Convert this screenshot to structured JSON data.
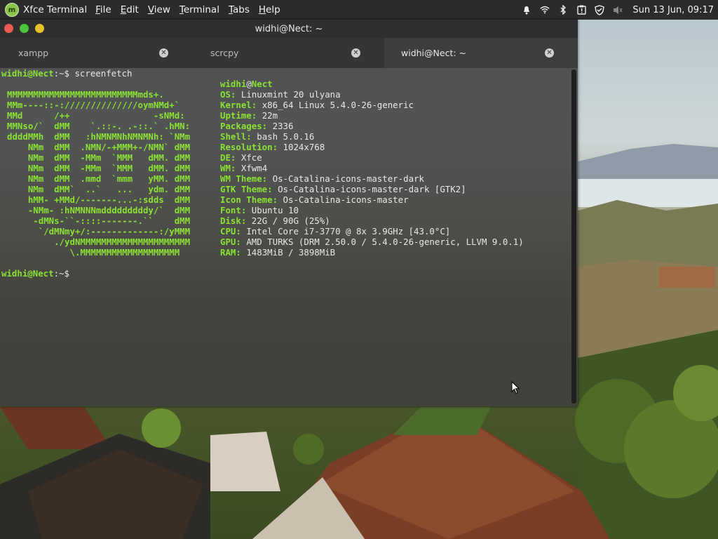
{
  "panel": {
    "app_name": "Xfce Terminal",
    "menus": [
      {
        "first": "F",
        "rest": "ile"
      },
      {
        "first": "E",
        "rest": "dit"
      },
      {
        "first": "V",
        "rest": "iew"
      },
      {
        "first": "T",
        "rest": "erminal"
      },
      {
        "first": "T",
        "rest": "abs"
      },
      {
        "first": "H",
        "rest": "elp"
      }
    ],
    "clock": "Sun 13 Jun, 09:17",
    "tray_icons": [
      "bell-icon",
      "wifi-icon",
      "bluetooth-icon",
      "clipboard-icon",
      "shield-icon",
      "volume-muted-icon"
    ]
  },
  "window": {
    "title": "widhi@Nect: ~",
    "tabs": [
      {
        "label": "xampp",
        "active": false
      },
      {
        "label": "scrcpy",
        "active": false
      },
      {
        "label": "widhi@Nect: ~",
        "active": true
      }
    ]
  },
  "terminal": {
    "prompt_user": "widhi@Nect",
    "prompt_path": ":~$ ",
    "command": "screenfetch",
    "logo_lines": [
      "MMMMMMMMMMMMMMMMMMMMMMMMMmds+.",
      "MMm----::-://////////////oymNMd+`",
      "MMd      /++                -sNMd:",
      "MMNso/`  dMM    `.::-. .-::.` .hMN:",
      "ddddMMh  dMM   :hNMNMNhNMNMNh: `NMm",
      "    NMm  dMM  .NMN/-+MMM+-/NMN` dMM",
      "    NMm  dMM  -MMm  `MMM   dMM. dMM",
      "    NMm  dMM  -MMm  `MMM   dMM. dMM",
      "    NMm  dMM  .mmd  `mmm   yMM. dMM",
      "    NMm  dMM`  ..`   ...   ydm. dMM",
      "    hMM- +MMd/-------...-:sdds  dMM",
      "    -NMm- :hNMNNNmdddddddddy/`  dMM",
      "     -dMNs-``-::::-------.``    dMM",
      "      `/dMNmy+/:-------------:/yMMM",
      "         ./ydNMMMMMMMMMMMMMMMMMMMMM",
      "            \\.MMMMMMMMMMMMMMMMMMM"
    ],
    "userhost": {
      "user": "widhi",
      "at": "@",
      "host": "Nect"
    },
    "info": [
      {
        "key": "OS:",
        "value": "Linuxmint 20 ulyana"
      },
      {
        "key": "Kernel:",
        "value": "x86_64 Linux 5.4.0-26-generic"
      },
      {
        "key": "Uptime:",
        "value": "22m"
      },
      {
        "key": "Packages:",
        "value": "2336"
      },
      {
        "key": "Shell:",
        "value": "bash 5.0.16"
      },
      {
        "key": "Resolution:",
        "value": "1024x768"
      },
      {
        "key": "DE:",
        "value": "Xfce"
      },
      {
        "key": "WM:",
        "value": "Xfwm4"
      },
      {
        "key": "WM Theme:",
        "value": "Os-Catalina-icons-master-dark"
      },
      {
        "key": "GTK Theme:",
        "value": "Os-Catalina-icons-master-dark [GTK2]"
      },
      {
        "key": "Icon Theme:",
        "value": "Os-Catalina-icons-master"
      },
      {
        "key": "Font:",
        "value": "Ubuntu 10"
      },
      {
        "key": "Disk:",
        "value": "22G / 90G (25%)"
      },
      {
        "key": "CPU:",
        "value": "Intel Core i7-3770 @ 8x 3.9GHz [43.0°C]"
      },
      {
        "key": "GPU:",
        "value": "AMD TURKS (DRM 2.50.0 / 5.4.0-26-generic, LLVM 9.0.1)"
      },
      {
        "key": "RAM:",
        "value": "1483MiB / 3898MiB"
      }
    ]
  },
  "colors": {
    "accent_green": "#8ae234",
    "close": "#ec5a53",
    "minimize": "#4dc23c",
    "maximize": "#e5c12a"
  }
}
